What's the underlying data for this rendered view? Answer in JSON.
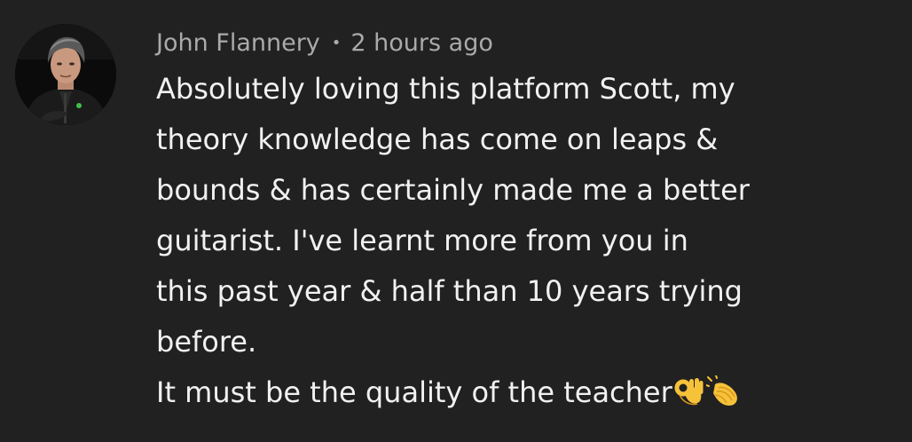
{
  "comment": {
    "author": "John Flannery",
    "separator": "•",
    "timestamp": "2 hours ago",
    "lines": [
      "Absolutely loving this platform Scott, my",
      "theory knowledge has come on leaps &",
      "bounds & has certainly made me a better",
      "guitarist. I've learnt more from you in",
      "this past year & half than 10 years trying",
      "before.",
      "It must be the quality of the teacher"
    ],
    "emojis": [
      "ok-hand-icon",
      "clapping-hands-icon"
    ]
  },
  "colors": {
    "background": "#212121",
    "text": "#f1f1f1",
    "meta": "#aaaaaa",
    "emoji": "#f6c23a"
  }
}
